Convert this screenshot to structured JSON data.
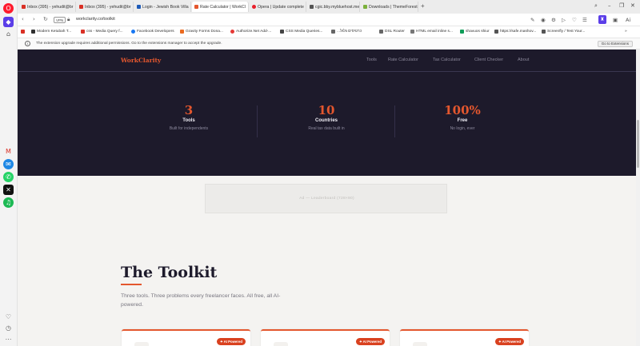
{
  "browser": {
    "tabs": [
      {
        "title": "Inbox (395) - yehudit@br",
        "color": "#d93025",
        "active": false
      },
      {
        "title": "Inbox (395) - yehudit@br",
        "color": "#d93025",
        "active": false
      },
      {
        "title": "Login - Jewish Book Villa",
        "color": "#1e5bb8",
        "active": false
      },
      {
        "title": "Rate Calculator | WorkCl",
        "color": "#e4572e",
        "active": true
      },
      {
        "title": "Opera | Update complete",
        "color": "#e8202b",
        "active": false
      },
      {
        "title": "cgic.bby.mybluehost.me",
        "color": "#555555",
        "active": false
      },
      {
        "title": "Downloads | ThemeForest",
        "color": "#7bb13c",
        "active": false
      }
    ],
    "new_tab": "+",
    "address": {
      "vpn": "VPN",
      "url": "workclarity.co/toolkit"
    },
    "bookmarks": [
      {
        "label": "Modern Ketubah T...",
        "color": "#2f2f2f"
      },
      {
        "label": "css - Media Query f...",
        "color": "#d93025"
      },
      {
        "label": "Facebook Developers",
        "color": "#1877f2"
      },
      {
        "label": "Gravity Forms Dona...",
        "color": "#ea6a1f"
      },
      {
        "label": "Authorize.Net Add-...",
        "color": "#e53935"
      },
      {
        "label": "CSS Media Queries...",
        "color": "#444444"
      },
      {
        "label": "...כרטיסים גלגל",
        "color": "#666666"
      },
      {
        "label": "DSL Router",
        "color": "#666666"
      },
      {
        "label": "HTML email inline s...",
        "color": "#777777"
      },
      {
        "label": "shavuos shiur",
        "color": "#0f9d58"
      },
      {
        "label": "https://safe.mashov...",
        "color": "#555555"
      },
      {
        "label": "Screenfly / Test Your...",
        "color": "#555555"
      }
    ],
    "info_bar": {
      "text": "The extension upgrade requires additional permissions. Go to the extensions manager to accept the upgrade.",
      "button": "Go to Extensions"
    }
  },
  "site": {
    "logo": "WorkClarity",
    "nav": [
      "Tools",
      "Rate Calculator",
      "Tax Calculator",
      "Client Checker",
      "About"
    ],
    "stats": [
      {
        "number": "3",
        "label": "Tools",
        "sub": "Built for independents"
      },
      {
        "number": "10",
        "label": "Countries",
        "sub": "Real tax data built in"
      },
      {
        "number": "100%",
        "label": "Free",
        "sub": "No login, ever"
      }
    ],
    "ad_placeholder": "Ad — Leaderboard (728×90)",
    "toolkit": {
      "title": "The Toolkit",
      "description": "Three tools. Three problems every freelancer faces. All free, all AI-powered.",
      "cards": [
        {
          "badge": "AI Powered"
        },
        {
          "badge": "AI Powered"
        },
        {
          "badge": "AI Powered"
        }
      ]
    }
  },
  "colors": {
    "accent": "#e4572e",
    "dark_bg": "#1d1a2b",
    "page_bg": "#f4f3f1"
  }
}
